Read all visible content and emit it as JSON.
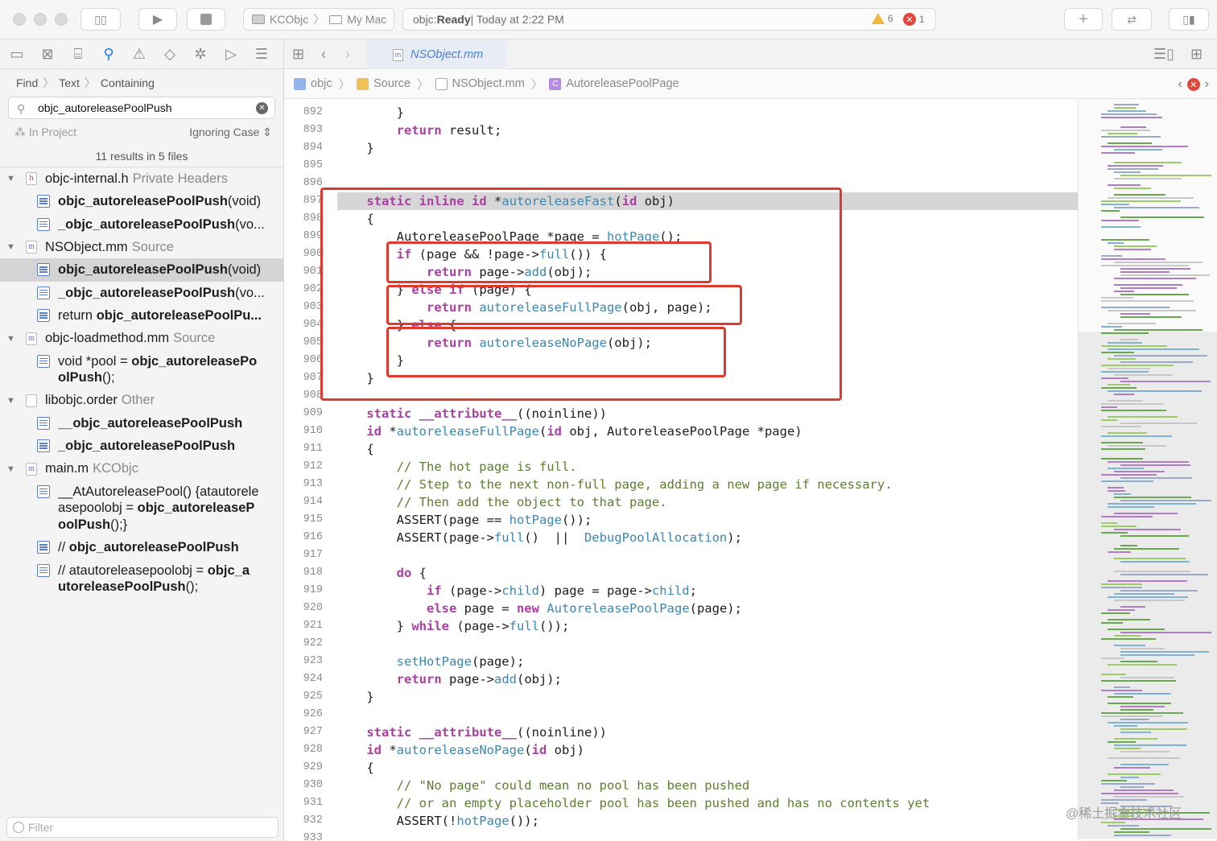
{
  "toolbar": {
    "scheme_project": "KCObjc",
    "scheme_target": "My Mac",
    "status_name": "objc: ",
    "status_state": "Ready",
    "status_time": " | Today at 2:22 PM",
    "warning_count": "6",
    "error_count": "1"
  },
  "navigator": {
    "find_mode": "Find",
    "find_type": "Text",
    "find_match": "Containing",
    "search_value": "objc_autoreleasePoolPush",
    "scope": "In Project",
    "case_option": "Ignoring Case",
    "results_summary": "11 results in 5 files",
    "filter_placeholder": "Filter"
  },
  "results": [
    {
      "file": "objc-internal.h",
      "group": "Private Headers",
      "icon": "h",
      "matches": [
        {
          "pre": "",
          "bold": "objc_autoreleasePoolPush",
          "post": "(void)"
        },
        {
          "pre": "",
          "bold": "_objc_autoreleasePoolPush",
          "post": "(vo..."
        }
      ]
    },
    {
      "file": "NSObject.mm",
      "group": "Source",
      "icon": "m",
      "matches": [
        {
          "pre": "",
          "bold": "objc_autoreleasePoolPush",
          "post": "(void)",
          "selected": true
        },
        {
          "pre": "",
          "bold": "_objc_autoreleasePoolPush",
          "post": "(vo..."
        },
        {
          "pre": "return ",
          "bold": "objc_autoreleasePoolPu...",
          "post": ""
        }
      ]
    },
    {
      "file": "objc-loadmethod.mm",
      "group": "Source",
      "icon": "m",
      "matches": [
        {
          "pre": "void *pool = ",
          "bold": "objc_autoreleasePo olPush",
          "post": "();",
          "wrap": true
        }
      ]
    },
    {
      "file": "libobjc.order",
      "group": "Other",
      "icon": "o",
      "matches": [
        {
          "pre": "",
          "bold": "__objc_autoreleasePoolPush",
          "post": ""
        },
        {
          "pre": "",
          "bold": "_objc_autoreleasePoolPush",
          "post": ""
        }
      ]
    },
    {
      "file": "main.m",
      "group": "KCObjc",
      "icon": "m",
      "matches": [
        {
          "pre": "__AtAutoreleasePool() {atautorele asepoolobj = ",
          "bold": "objc_autoreleaseP oolPush",
          "post": "();}",
          "wrap": true
        },
        {
          "pre": "// ",
          "bold": "objc_autoreleasePoolPush",
          "post": ""
        },
        {
          "pre": "// atautoreleasepoolobj = ",
          "bold": "objc_a utoreleasePoolPush",
          "post": "();",
          "wrap": true
        }
      ]
    }
  ],
  "editor": {
    "tab_title": "NSObject.mm",
    "breadcrumb": [
      "objc",
      "Source",
      "NSObject.mm",
      "AutoreleasePoolPage"
    ]
  },
  "code_lines": [
    {
      "n": "892",
      "t": [
        [
          "",
          "        }"
        ]
      ]
    },
    {
      "n": "893",
      "t": [
        [
          "",
          "        "
        ],
        [
          "kw",
          "return"
        ],
        [
          "",
          " result;"
        ]
      ]
    },
    {
      "n": "894",
      "t": [
        [
          "",
          "    }"
        ]
      ]
    },
    {
      "n": "895",
      "t": [
        [
          "",
          ""
        ]
      ]
    },
    {
      "n": "896",
      "t": [
        [
          "",
          ""
        ]
      ]
    },
    {
      "n": "897",
      "t": [
        [
          "",
          "    "
        ],
        [
          "kw",
          "static"
        ],
        [
          "",
          " "
        ],
        [
          "kw",
          "inline"
        ],
        [
          "",
          " "
        ],
        [
          "kw",
          "id"
        ],
        [
          "",
          " *"
        ],
        [
          "fn",
          "autoreleaseFast"
        ],
        [
          "",
          "("
        ],
        [
          "kw",
          "id"
        ],
        [
          "",
          " obj)"
        ]
      ]
    },
    {
      "n": "898",
      "t": [
        [
          "",
          "    {"
        ]
      ]
    },
    {
      "n": "899",
      "t": [
        [
          "",
          "        AutoreleasePoolPage *page = "
        ],
        [
          "fn",
          "hotPage"
        ],
        [
          "",
          "();"
        ]
      ]
    },
    {
      "n": "900",
      "t": [
        [
          "",
          "        "
        ],
        [
          "kw",
          "if"
        ],
        [
          "",
          " (page && !page->"
        ],
        [
          "fn",
          "full"
        ],
        [
          "",
          "()) {"
        ]
      ]
    },
    {
      "n": "901",
      "t": [
        [
          "",
          "            "
        ],
        [
          "kw",
          "return"
        ],
        [
          "",
          " page->"
        ],
        [
          "fn",
          "add"
        ],
        [
          "",
          "(obj);"
        ]
      ]
    },
    {
      "n": "902",
      "t": [
        [
          "",
          "        } "
        ],
        [
          "kw",
          "else if"
        ],
        [
          "",
          " (page) {"
        ]
      ]
    },
    {
      "n": "903",
      "t": [
        [
          "",
          "            "
        ],
        [
          "kw",
          "return"
        ],
        [
          "",
          " "
        ],
        [
          "fn",
          "autoreleaseFullPage"
        ],
        [
          "",
          "(obj, page);"
        ]
      ]
    },
    {
      "n": "904",
      "t": [
        [
          "",
          "        } "
        ],
        [
          "kw",
          "else"
        ],
        [
          "",
          " {"
        ]
      ]
    },
    {
      "n": "905",
      "t": [
        [
          "",
          "            "
        ],
        [
          "kw",
          "return"
        ],
        [
          "",
          " "
        ],
        [
          "fn",
          "autoreleaseNoPage"
        ],
        [
          "",
          "(obj);"
        ]
      ]
    },
    {
      "n": "906",
      "t": [
        [
          "",
          "        }"
        ]
      ]
    },
    {
      "n": "907",
      "t": [
        [
          "",
          "    }"
        ]
      ]
    },
    {
      "n": "908",
      "t": [
        [
          "",
          ""
        ]
      ]
    },
    {
      "n": "909",
      "t": [
        [
          "",
          "    "
        ],
        [
          "kw",
          "static"
        ],
        [
          "",
          " "
        ],
        [
          "kw",
          "__attribute__"
        ],
        [
          "",
          "((noinline))"
        ]
      ]
    },
    {
      "n": "910",
      "t": [
        [
          "",
          "    "
        ],
        [
          "kw",
          "id"
        ],
        [
          "",
          " *"
        ],
        [
          "fn",
          "autoreleaseFullPage"
        ],
        [
          "",
          "("
        ],
        [
          "kw",
          "id"
        ],
        [
          "",
          " obj, AutoreleasePoolPage *page)"
        ]
      ]
    },
    {
      "n": "911",
      "t": [
        [
          "",
          "    {"
        ]
      ]
    },
    {
      "n": "912",
      "t": [
        [
          "",
          "        "
        ],
        [
          "cm",
          "// The hot page is full."
        ]
      ]
    },
    {
      "n": "913",
      "t": [
        [
          "",
          "        "
        ],
        [
          "cm",
          "// Step to the next non-full page, adding a new page if necessary."
        ]
      ]
    },
    {
      "n": "914",
      "t": [
        [
          "",
          "        "
        ],
        [
          "cm",
          "// Then add the object to that page."
        ]
      ]
    },
    {
      "n": "915",
      "t": [
        [
          "",
          "        ASSERT(page == "
        ],
        [
          "fn",
          "hotPage"
        ],
        [
          "",
          "());"
        ]
      ]
    },
    {
      "n": "916",
      "t": [
        [
          "",
          "        ASSERT(page->"
        ],
        [
          "fn",
          "full"
        ],
        [
          "",
          "()  ||  "
        ],
        [
          "fn",
          "DebugPoolAllocation"
        ],
        [
          "",
          ");"
        ]
      ]
    },
    {
      "n": "917",
      "t": [
        [
          "",
          ""
        ]
      ]
    },
    {
      "n": "918",
      "t": [
        [
          "",
          "        "
        ],
        [
          "kw",
          "do"
        ],
        [
          "",
          " {"
        ]
      ]
    },
    {
      "n": "919",
      "t": [
        [
          "",
          "            "
        ],
        [
          "kw",
          "if"
        ],
        [
          "",
          " (page->"
        ],
        [
          "fn",
          "child"
        ],
        [
          "",
          ") page = page->"
        ],
        [
          "fn",
          "child"
        ],
        [
          "",
          ";"
        ]
      ]
    },
    {
      "n": "920",
      "t": [
        [
          "",
          "            "
        ],
        [
          "kw",
          "else"
        ],
        [
          "",
          " page = "
        ],
        [
          "kw",
          "new"
        ],
        [
          "",
          " "
        ],
        [
          "fn",
          "AutoreleasePoolPage"
        ],
        [
          "",
          "(page);"
        ]
      ]
    },
    {
      "n": "921",
      "t": [
        [
          "",
          "        } "
        ],
        [
          "kw",
          "while"
        ],
        [
          "",
          " (page->"
        ],
        [
          "fn",
          "full"
        ],
        [
          "",
          "());"
        ]
      ]
    },
    {
      "n": "922",
      "t": [
        [
          "",
          ""
        ]
      ]
    },
    {
      "n": "923",
      "t": [
        [
          "",
          "        "
        ],
        [
          "fn",
          "setHotPage"
        ],
        [
          "",
          "(page);"
        ]
      ]
    },
    {
      "n": "924",
      "t": [
        [
          "",
          "        "
        ],
        [
          "kw",
          "return"
        ],
        [
          "",
          " page->"
        ],
        [
          "fn",
          "add"
        ],
        [
          "",
          "(obj);"
        ]
      ]
    },
    {
      "n": "925",
      "t": [
        [
          "",
          "    }"
        ]
      ]
    },
    {
      "n": "926",
      "t": [
        [
          "",
          ""
        ]
      ]
    },
    {
      "n": "927",
      "t": [
        [
          "",
          "    "
        ],
        [
          "kw",
          "static"
        ],
        [
          "",
          " "
        ],
        [
          "kw",
          "__attribute__"
        ],
        [
          "",
          "((noinline))"
        ]
      ]
    },
    {
      "n": "928",
      "t": [
        [
          "",
          "    "
        ],
        [
          "kw",
          "id"
        ],
        [
          "",
          " *"
        ],
        [
          "fn",
          "autoreleaseNoPage"
        ],
        [
          "",
          "("
        ],
        [
          "kw",
          "id"
        ],
        [
          "",
          " obj)"
        ]
      ]
    },
    {
      "n": "929",
      "t": [
        [
          "",
          "    {"
        ]
      ]
    },
    {
      "n": "930",
      "t": [
        [
          "",
          "        "
        ],
        [
          "cm",
          "// \"No page\" could mean no pool has been pushed"
        ]
      ]
    },
    {
      "n": "931",
      "t": [
        [
          "",
          "        "
        ],
        [
          "cm",
          "// or an empty placeholder pool has been pushed and has no contents yet"
        ]
      ]
    },
    {
      "n": "932",
      "t": [
        [
          "",
          "        ASSERT(!"
        ],
        [
          "fn",
          "hotPage"
        ],
        [
          "",
          "());"
        ]
      ]
    },
    {
      "n": "933",
      "t": [
        [
          "",
          ""
        ]
      ]
    }
  ],
  "watermark": "@稀土掘金技术社区",
  "colors": {
    "keyword": "#a83fa1",
    "function": "#3c87b0",
    "comment": "#5d7d2f",
    "annotation_box": "#e03a2e",
    "accent": "#1f7bf0"
  }
}
